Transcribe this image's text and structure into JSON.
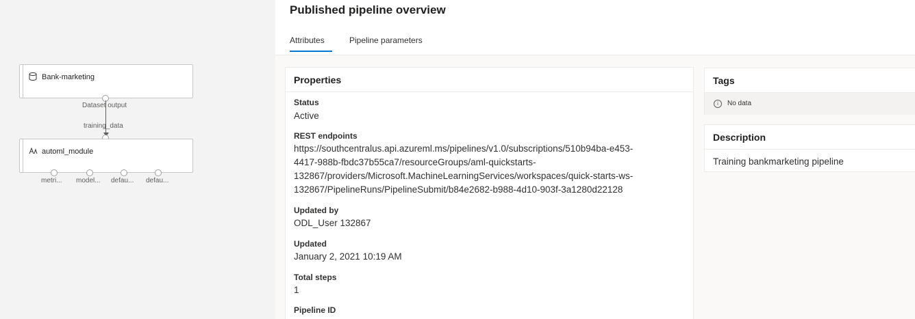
{
  "canvas": {
    "node1": {
      "title": "Bank-marketing",
      "icon": "database-icon"
    },
    "edge": {
      "output_label": "Dataset output",
      "input_label": "training_data"
    },
    "node2": {
      "title": "automl_module",
      "icon": "automl-icon",
      "ports": [
        "metri...",
        "model...",
        "defau...",
        "defau..."
      ]
    }
  },
  "main": {
    "title": "Published pipeline overview",
    "tabs": [
      {
        "label": "Attributes",
        "active": true
      },
      {
        "label": "Pipeline parameters",
        "active": false
      }
    ],
    "properties": {
      "title": "Properties",
      "status_label": "Status",
      "status_value": "Active",
      "rest_label": "REST endpoints",
      "rest_lines": [
        "https://southcentralus.api.azureml.ms/pipelines/v1.0/subscriptions/510b94ba-e453-",
        "4417-988b-fbdc37b55ca7/resourceGroups/aml-quickstarts-",
        "132867/providers/Microsoft.MachineLearningServices/workspaces/quick-starts-ws-",
        "132867/PipelineRuns/PipelineSubmit/b84e2682-b988-4d10-903f-3a1280d22128"
      ],
      "updated_by_label": "Updated by",
      "updated_by_value": "ODL_User 132867",
      "updated_label": "Updated",
      "updated_value": "January 2, 2021 10:19 AM",
      "total_steps_label": "Total steps",
      "total_steps_value": "1",
      "pipeline_id_label": "Pipeline ID"
    },
    "tags": {
      "title": "Tags",
      "empty_text": "No data",
      "empty_icon": "info-icon"
    },
    "description": {
      "title": "Description",
      "text": "Training bankmarketing pipeline"
    }
  },
  "colors": {
    "accent": "#0078d4",
    "canvas_bg": "#f3f3f3",
    "panel_bg": "#faf9f8"
  }
}
